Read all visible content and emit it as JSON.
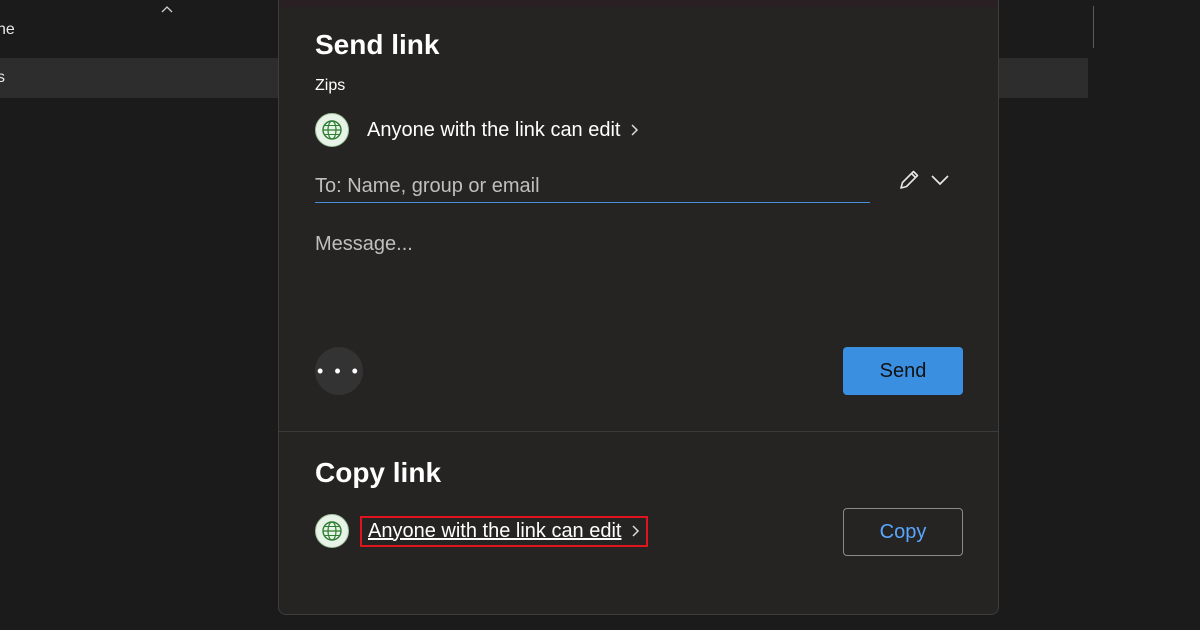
{
  "background": {
    "rows": [
      {
        "label": "ne"
      },
      {
        "label": "s"
      }
    ]
  },
  "dialog": {
    "send_section": {
      "title": "Send link",
      "file_name": "Zips",
      "permission_label": "Anyone with the link can edit",
      "to_placeholder": "To: Name, group or email",
      "message_placeholder": "Message...",
      "more_label": "• • •",
      "send_label": "Send"
    },
    "copy_section": {
      "title": "Copy link",
      "permission_label": "Anyone with the link can edit",
      "copy_label": "Copy"
    },
    "icons": {
      "globe": "globe-icon",
      "pencil": "pencil-icon",
      "chevron_down": "chevron-down-icon",
      "chevron_right": "chevron-right-icon"
    },
    "colors": {
      "accent": "#3a8fe0",
      "link": "#58a6ff",
      "highlight_border": "#e0141e",
      "dialog_bg": "#252423"
    }
  }
}
